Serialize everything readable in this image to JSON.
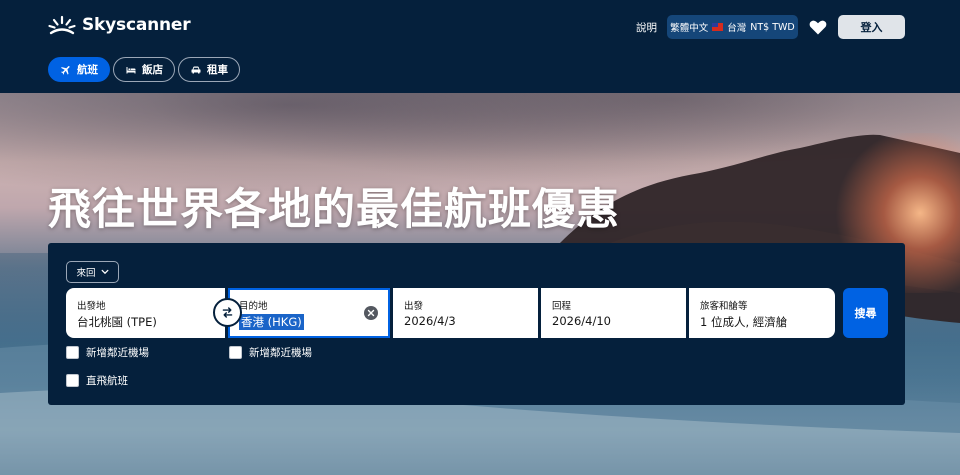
{
  "header": {
    "brand": "Skyscanner",
    "help_label": "說明",
    "locale": {
      "language": "繁體中文",
      "region": "台灣",
      "currency": "NT$ TWD"
    },
    "login_label": "登入",
    "icons": {
      "logo": "sunrise-logo-icon",
      "favorites": "heart-icon",
      "flag": "taiwan-flag-icon"
    }
  },
  "nav": {
    "tabs": [
      {
        "label": "航班",
        "icon": "plane-icon",
        "active": true
      },
      {
        "label": "飯店",
        "icon": "bed-icon",
        "active": false
      },
      {
        "label": "租車",
        "icon": "car-icon",
        "active": false
      }
    ]
  },
  "hero": {
    "title": "飛往世界各地的最佳航班優惠"
  },
  "search": {
    "trip_type": "來回",
    "origin": {
      "label": "出發地",
      "value": "台北桃園 (TPE)"
    },
    "destination": {
      "label": "目的地",
      "value": "香港 (HKG)"
    },
    "depart": {
      "label": "出發",
      "value": "2026/4/3"
    },
    "return": {
      "label": "回程",
      "value": "2026/4/10"
    },
    "travellers": {
      "label": "旅客和艙等",
      "value": "1 位成人, 經濟艙"
    },
    "search_label": "搜尋",
    "nearby_origin_label": "新增鄰近機場",
    "nearby_dest_label": "新增鄰近機場",
    "direct_label": "直飛航班"
  },
  "colors": {
    "navy": "#05203c",
    "primary_blue": "#0062e3",
    "locale_bg": "#154679"
  }
}
